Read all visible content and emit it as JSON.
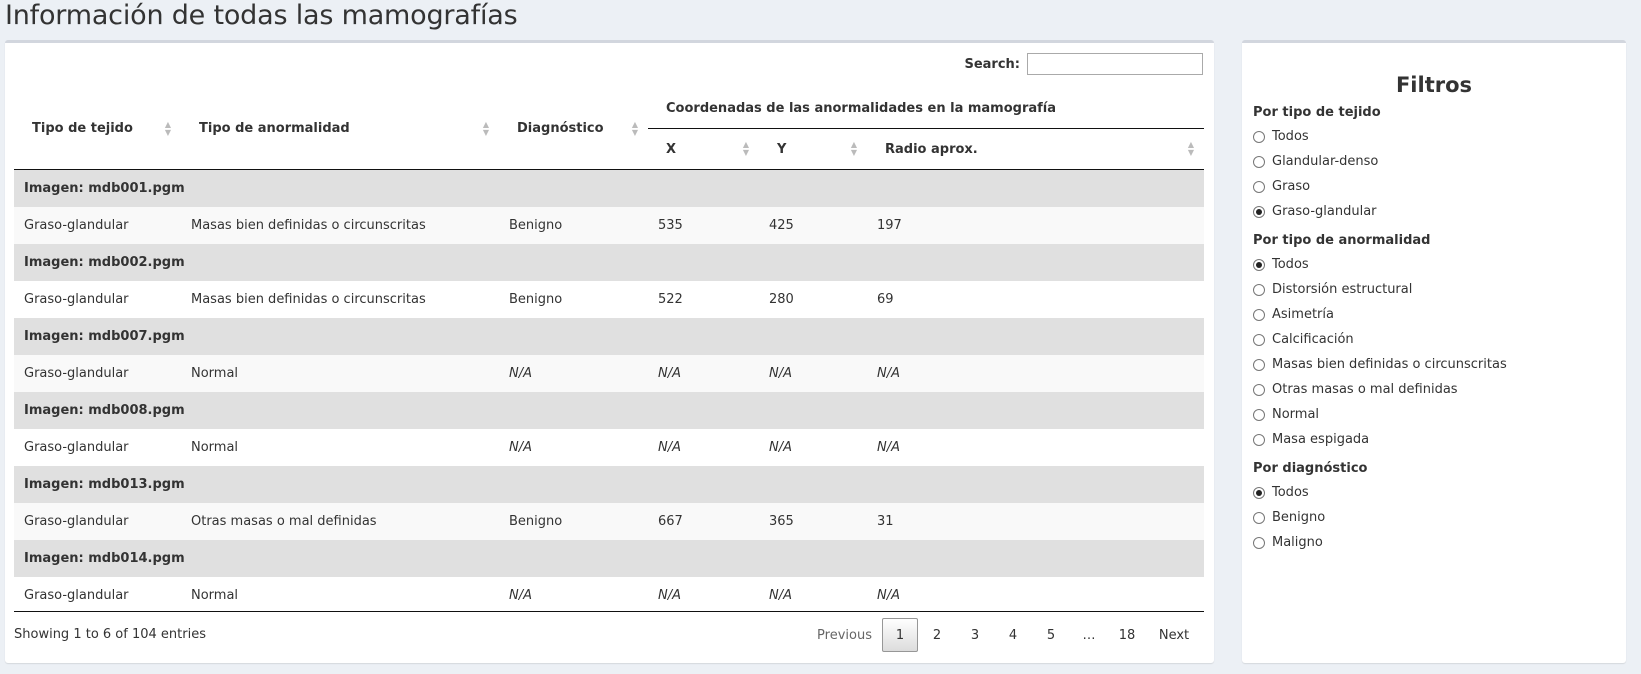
{
  "page_title": "Información de todas las mamografías",
  "search": {
    "label": "Search:",
    "value": ""
  },
  "table": {
    "headers": {
      "tejido": "Tipo de tejido",
      "anormalidad": "Tipo de anormalidad",
      "diagnostico": "Diagnóstico",
      "coords_group": "Coordenadas de las anormalidades en la mamografía",
      "x": "X",
      "y": "Y",
      "radio": "Radio aprox."
    },
    "groups": [
      {
        "image": "Imagen: mdb001.pgm",
        "row": [
          "Graso-glandular",
          "Masas bien definidas o circunscritas",
          "Benigno",
          "535",
          "425",
          "197"
        ]
      },
      {
        "image": "Imagen: mdb002.pgm",
        "row": [
          "Graso-glandular",
          "Masas bien definidas o circunscritas",
          "Benigno",
          "522",
          "280",
          "69"
        ]
      },
      {
        "image": "Imagen: mdb007.pgm",
        "row": [
          "Graso-glandular",
          "Normal",
          "N/A",
          "N/A",
          "N/A",
          "N/A"
        ]
      },
      {
        "image": "Imagen: mdb008.pgm",
        "row": [
          "Graso-glandular",
          "Normal",
          "N/A",
          "N/A",
          "N/A",
          "N/A"
        ]
      },
      {
        "image": "Imagen: mdb013.pgm",
        "row": [
          "Graso-glandular",
          "Otras masas o mal definidas",
          "Benigno",
          "667",
          "365",
          "31"
        ]
      },
      {
        "image": "Imagen: mdb014.pgm",
        "row": [
          "Graso-glandular",
          "Normal",
          "N/A",
          "N/A",
          "N/A",
          "N/A"
        ]
      }
    ]
  },
  "info": "Showing 1 to 6 of 104 entries",
  "pagination": {
    "previous": "Previous",
    "pages": [
      "1",
      "2",
      "3",
      "4",
      "5",
      "…",
      "18"
    ],
    "current": "1",
    "next": "Next"
  },
  "filters": {
    "title": "Filtros",
    "groups": [
      {
        "label": "Por tipo de tejido",
        "options": [
          "Todos",
          "Glandular-denso",
          "Graso",
          "Graso-glandular"
        ],
        "selected": "Graso-glandular"
      },
      {
        "label": "Por tipo de anormalidad",
        "options": [
          "Todos",
          "Distorsión estructural",
          "Asimetría",
          "Calcificación",
          "Masas bien definidas o circunscritas",
          "Otras masas o mal definidas",
          "Normal",
          "Masa espigada"
        ],
        "selected": "Todos"
      },
      {
        "label": "Por diagnóstico",
        "options": [
          "Todos",
          "Benigno",
          "Maligno"
        ],
        "selected": "Todos"
      }
    ]
  }
}
